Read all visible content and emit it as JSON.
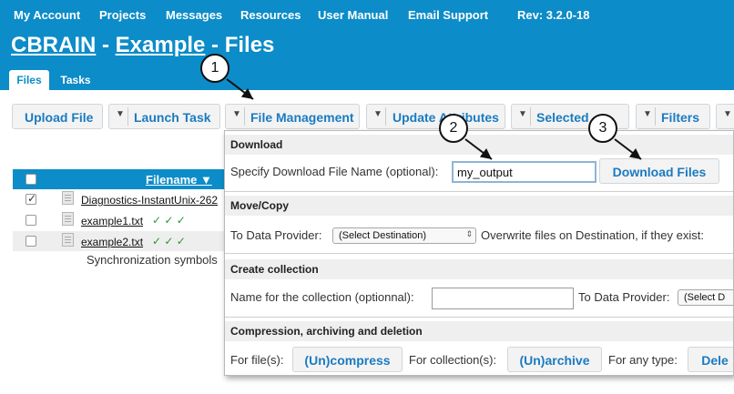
{
  "topnav": {
    "items": [
      "My Account",
      "Projects",
      "Messages",
      "Resources",
      "User Manual",
      "Email Support"
    ],
    "revision": "Rev: 3.2.0-18"
  },
  "header": {
    "app_name": "CBRAIN",
    "sep1": " - ",
    "project": "Example",
    "sep2": " - ",
    "page": "Files"
  },
  "tabs": [
    "Files",
    "Tasks"
  ],
  "toolbar": {
    "upload": "Upload File",
    "launch": "Launch Task",
    "file_management": "File Management",
    "update_attributes": "Update Attributes",
    "selected": "Selected",
    "filters": "Filters"
  },
  "files_table": {
    "header": "Filename ▼",
    "rows": [
      {
        "name": "Diagnostics-InstantUnix-262",
        "checks": "",
        "checked": true
      },
      {
        "name": "example1.txt",
        "checks": "✓ ✓ ✓",
        "checked": false
      },
      {
        "name": "example2.txt",
        "checks": "✓ ✓ ✓",
        "checked": false
      }
    ],
    "sync_note": "Synchronization symbols"
  },
  "panel": {
    "download": {
      "title": "Download",
      "label": "Specify Download File Name (optional):",
      "value": "my_output",
      "button": "Download Files"
    },
    "move_copy": {
      "title": "Move/Copy",
      "label": "To Data Provider:",
      "select": "(Select Destination)",
      "overwrite_label": "Overwrite files on Destination, if they exist:"
    },
    "collection": {
      "title": "Create collection",
      "name_label": "Name for the collection (optionnal):",
      "name_value": "",
      "dp_label": "To Data Provider:",
      "select": "(Select D"
    },
    "compression": {
      "title": "Compression, archiving and deletion",
      "files_label": "For file(s):",
      "compress_button": "(Un)compress",
      "collections_label": "For collection(s):",
      "archive_button": "(Un)archive",
      "any_label": "For any type:",
      "delete_button": "Dele"
    }
  },
  "callouts": [
    "1",
    "2",
    "3"
  ],
  "colors": {
    "brand": "#0c8cc8",
    "link": "#1b7bc1",
    "sync_ok": "#2a9a2a"
  }
}
